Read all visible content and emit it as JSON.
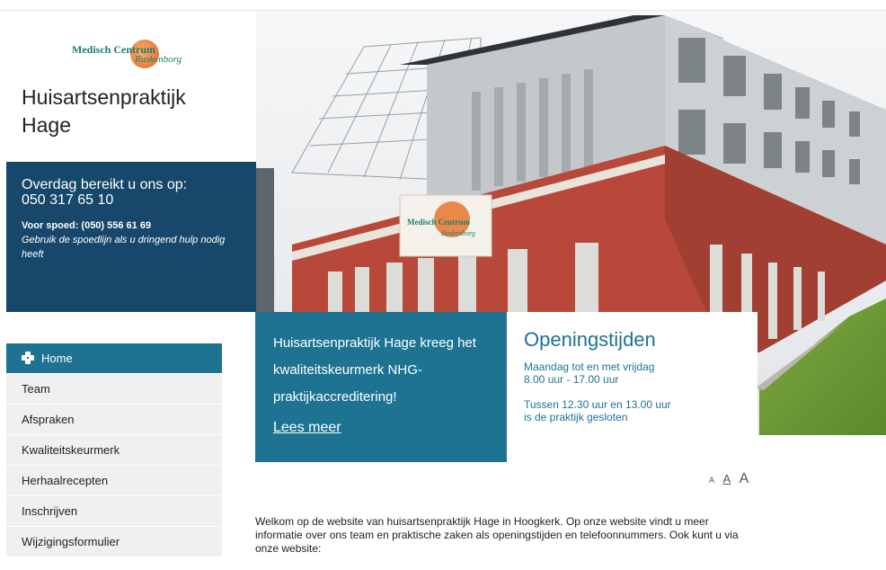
{
  "logo": {
    "line1": "Medisch Centrum",
    "line2": "Ruskenborg"
  },
  "site_title": "Huisartsenpraktijk Hage",
  "contact": {
    "line1": "Overdag bereikt u ons op:",
    "phone": "050 317 65 10",
    "urgent": "Voor spoed: (050) 556 61 69",
    "urgent_note": "Gebruik de spoedlijn als u dringend hulp nodig heeft"
  },
  "hero": {
    "sign_line1": "Medisch Centrum",
    "sign_line2": "Ruskenborg"
  },
  "news": {
    "text": "Huisartsenpraktijk Hage kreeg het kwaliteitskeurmerk NHG-praktijkaccreditering!",
    "link": "Lees meer"
  },
  "hours": {
    "title": "Openingstijden",
    "line1": "Maandag tot en met vrijdag",
    "line2": "8.00 uur - 17.00 uur",
    "line3": "Tussen 12.30 uur en 13.00 uur",
    "line4": "is de praktijk gesloten"
  },
  "font_size_controls": [
    "A",
    "A",
    "A"
  ],
  "nav": {
    "items": [
      {
        "label": "Home",
        "active": true,
        "icon": "home-icon"
      },
      {
        "label": "Team"
      },
      {
        "label": "Afspraken"
      },
      {
        "label": "Kwaliteitskeurmerk"
      },
      {
        "label": "Herhaalrecepten"
      },
      {
        "label": "Inschrijven"
      },
      {
        "label": "Wijzigingsformulier"
      }
    ]
  },
  "welcome": "Welkom op de website van huisartsenpraktijk Hage in Hoogkerk. Op onze website vindt u meer informatie over ons team en praktische zaken als openingstijden en telefoonnummers. Ook kunt u via onze website:",
  "colors": {
    "dark_blue": "#17476a",
    "teal": "#1e7392",
    "nav_bg": "#f0f0f0",
    "brick": "#b8493a",
    "grass": "#6f9a3a"
  }
}
